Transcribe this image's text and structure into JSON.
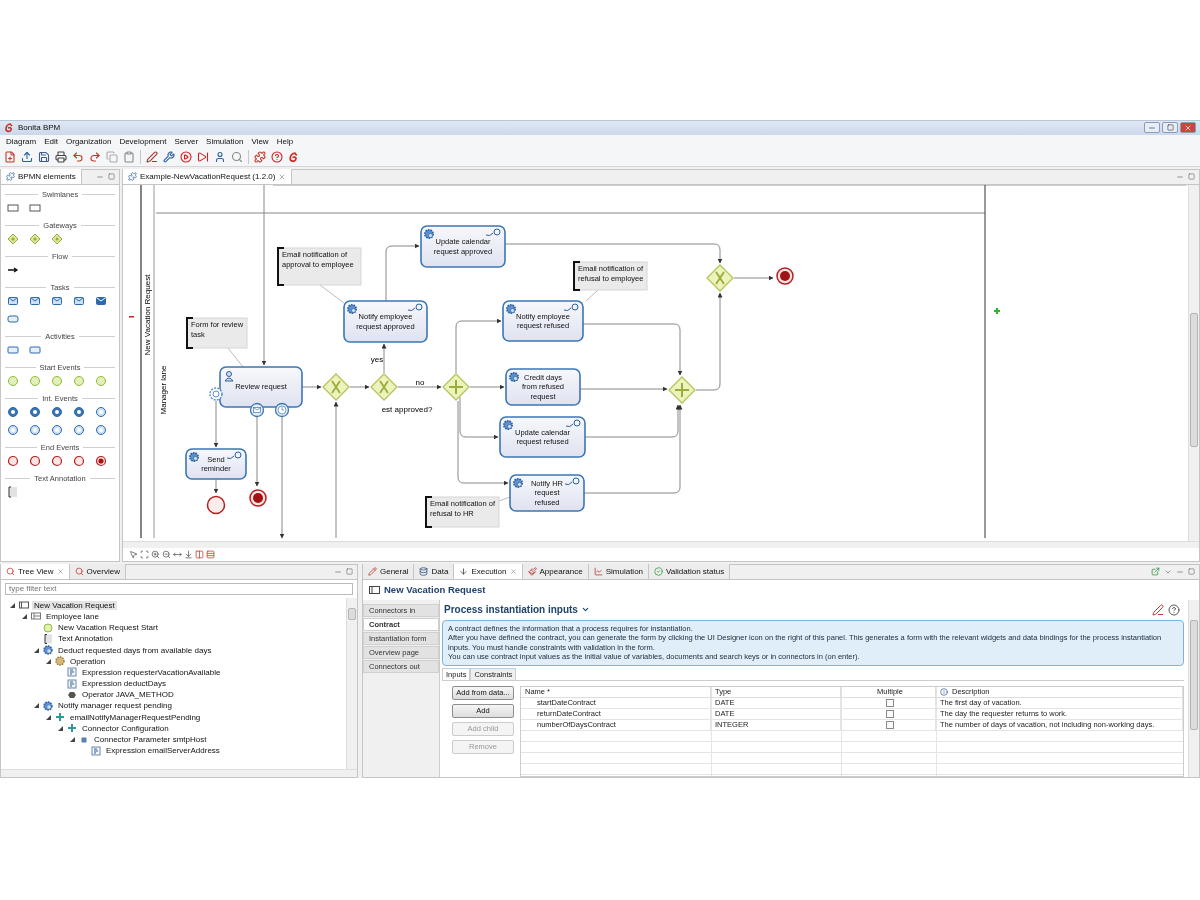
{
  "window": {
    "title": "Bonita BPM"
  },
  "menu": [
    "Diagram",
    "Edit",
    "Organization",
    "Development",
    "Server",
    "Simulation",
    "View",
    "Help"
  ],
  "palette": {
    "title": "BPMN elements",
    "sections": [
      {
        "title": "Swimlanes"
      },
      {
        "title": "Gateways"
      },
      {
        "title": "Flow"
      },
      {
        "title": "Tasks"
      },
      {
        "title": "Activities"
      },
      {
        "title": "Start Events"
      },
      {
        "title": "Int. Events"
      },
      {
        "title": "End Events"
      },
      {
        "title": "Text Annotation"
      }
    ]
  },
  "editor": {
    "tab": "Example-NewVacationRequest (1.2.0)",
    "diagram": {
      "pool": "New Vacation Request",
      "lane": "Manager lane",
      "tasks": [
        {
          "label": "Review request",
          "kind": "human",
          "has_connector": false
        },
        {
          "label": "Send reminder",
          "kind": "service",
          "has_connector": true
        },
        {
          "label": "Notify employee request approved",
          "kind": "service",
          "has_connector": true
        },
        {
          "label": "Update calendar request approved",
          "kind": "service",
          "has_connector": true
        },
        {
          "label": "Notify employee request refused",
          "kind": "service",
          "has_connector": true
        },
        {
          "label": "Credit days from refused request",
          "kind": "service",
          "has_connector": false
        },
        {
          "label": "Update calendar request refused",
          "kind": "service",
          "has_connector": true
        },
        {
          "label": "Notify HR request refused",
          "kind": "service",
          "has_connector": true
        }
      ],
      "gateways": [
        {
          "kind": "exclusive"
        },
        {
          "kind": "exclusive",
          "label": "est approved?"
        },
        {
          "kind": "parallel"
        },
        {
          "kind": "parallel"
        },
        {
          "kind": "exclusive"
        }
      ],
      "events": [
        {
          "kind": "end"
        },
        {
          "kind": "terminate"
        },
        {
          "kind": "terminate"
        }
      ],
      "boundary_events": [
        {
          "kind": "gear"
        },
        {
          "kind": "message"
        },
        {
          "kind": "timer"
        }
      ],
      "flow_labels": [
        "yes",
        "no"
      ],
      "annotations": [
        "Email notification of approval to employee",
        "Form for review task",
        "Email notification of refusal to employee",
        "Email notification of refusal to HR"
      ]
    }
  },
  "tree_panel": {
    "tabs": [
      {
        "label": "Tree View",
        "selected": true
      },
      {
        "label": "Overview",
        "selected": false
      }
    ],
    "filter": {
      "placeholder": "type filter text"
    },
    "items": [
      {
        "label": "New Vacation Request",
        "kind": "pool",
        "selected": true,
        "expanded": true,
        "children": [
          {
            "label": "Employee lane",
            "kind": "lane",
            "selected": false,
            "expanded": true,
            "children": [
              {
                "label": "New Vacation Request Start",
                "kind": "start",
                "selected": false
              },
              {
                "label": "Text Annotation",
                "kind": "annotation",
                "selected": false
              },
              {
                "label": "Deduct requested days from available days",
                "kind": "service",
                "selected": false,
                "expanded": true,
                "children": [
                  {
                    "label": "Operation",
                    "kind": "operation",
                    "selected": false,
                    "expanded": true,
                    "children": [
                      {
                        "label": "Expression requesterVacationAvailable",
                        "kind": "expression",
                        "selected": false
                      },
                      {
                        "label": "Expression deductDays",
                        "kind": "expression",
                        "selected": false
                      },
                      {
                        "label": "Operator JAVA_METHOD",
                        "kind": "operator",
                        "selected": false
                      }
                    ]
                  }
                ]
              },
              {
                "label": "Notify manager request pending",
                "kind": "service",
                "selected": false,
                "expanded": true,
                "children": [
                  {
                    "label": "emailNotifyManagerRequestPending",
                    "kind": "connector",
                    "selected": false,
                    "expanded": true,
                    "children": [
                      {
                        "label": "Connector Configuration",
                        "kind": "connector",
                        "selected": false,
                        "expanded": true,
                        "children": [
                          {
                            "label": "Connector Parameter smtpHost",
                            "kind": "parameter",
                            "selected": false,
                            "expanded": true,
                            "children": [
                              {
                                "label": "Expression emailServerAddress",
                                "kind": "expression",
                                "selected": false
                              }
                            ]
                          }
                        ]
                      }
                    ]
                  }
                ]
              }
            ]
          }
        ]
      }
    ]
  },
  "properties": {
    "tabs": [
      {
        "label": "General",
        "selected": false
      },
      {
        "label": "Data",
        "selected": false
      },
      {
        "label": "Execution",
        "selected": true
      },
      {
        "label": "Appearance",
        "selected": false
      },
      {
        "label": "Simulation",
        "selected": false
      },
      {
        "label": "Validation status",
        "selected": false
      }
    ],
    "title": "New Vacation Request",
    "side_tabs": [
      {
        "label": "Connectors in",
        "selected": false
      },
      {
        "label": "Contract",
        "selected": true
      },
      {
        "label": "Instantiation form",
        "selected": false
      },
      {
        "label": "Overview page",
        "selected": false
      },
      {
        "label": "Connectors out",
        "selected": false
      }
    ],
    "section_title": "Process instantiation inputs",
    "info": [
      "A contract defines the information that a process requires for instantiation.",
      "After you have defined the contract, you can generate the form by clicking the UI Designer icon on the right of this panel. This generates a form with the relevant widgets and data bindings for the process instantiation inputs. You must handle constraints with validation in the form.",
      "You can use contract input values as the initial value of variables, documents and search keys or in connectors in (on enter)."
    ],
    "sub_tabs": [
      {
        "label": "Inputs",
        "selected": true
      },
      {
        "label": "Constraints",
        "selected": false
      }
    ],
    "buttons": [
      {
        "label": "Add from data...",
        "disabled": false
      },
      {
        "label": "Add",
        "disabled": false
      },
      {
        "label": "Add child",
        "disabled": true
      },
      {
        "label": "Remove",
        "disabled": true
      }
    ],
    "columns": [
      "Name *",
      "Type",
      "Multiple",
      "Description"
    ],
    "rows": [
      {
        "name": "startDateContract",
        "type": "DATE",
        "multiple": false,
        "description": "The first day of vacation."
      },
      {
        "name": "returnDateContract",
        "type": "DATE",
        "multiple": false,
        "description": "The day the requester returns to work."
      },
      {
        "name": "numberOfDaysContract",
        "type": "INTEGER",
        "multiple": false,
        "description": "The number of days of vacation, not including non-working days."
      }
    ]
  }
}
